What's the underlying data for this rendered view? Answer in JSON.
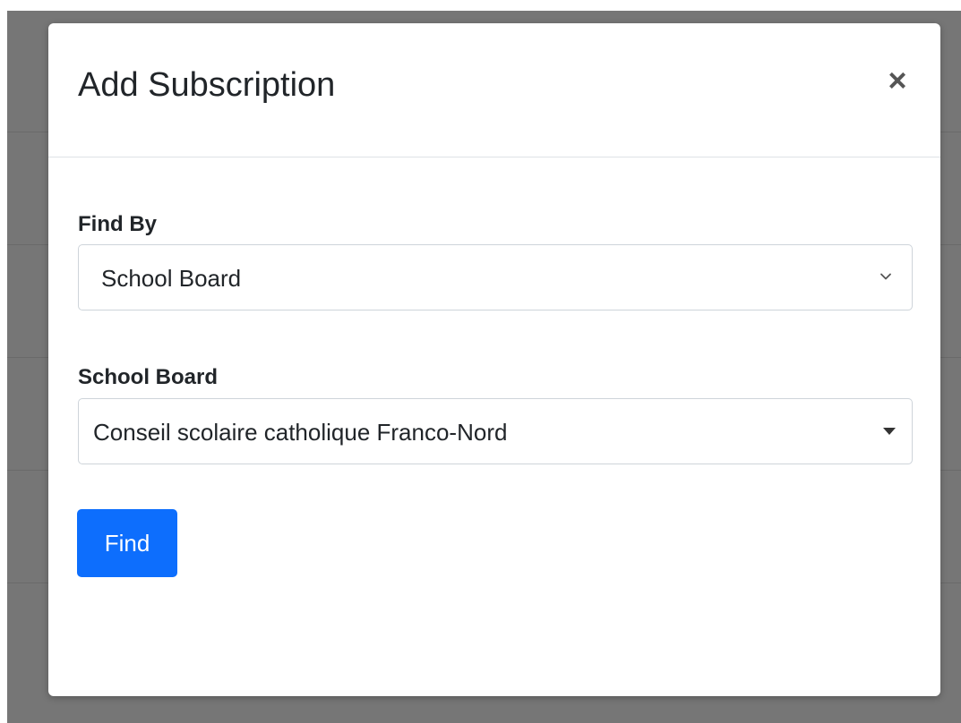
{
  "modal": {
    "title": "Add Subscription",
    "close_label": "×"
  },
  "form": {
    "find_by": {
      "label": "Find By",
      "selected": "School Board"
    },
    "school_board": {
      "label": "School Board",
      "selected": "Conseil scolaire catholique Franco-Nord"
    },
    "submit_label": "Find"
  },
  "colors": {
    "backdrop": "#767676",
    "primary_button": "#0d6efd",
    "input_border": "#ced4da",
    "text": "#212529"
  },
  "icons": {
    "close": "close-icon",
    "find_by_arrow": "chevron-down-icon",
    "school_board_arrow": "caret-down-icon"
  }
}
